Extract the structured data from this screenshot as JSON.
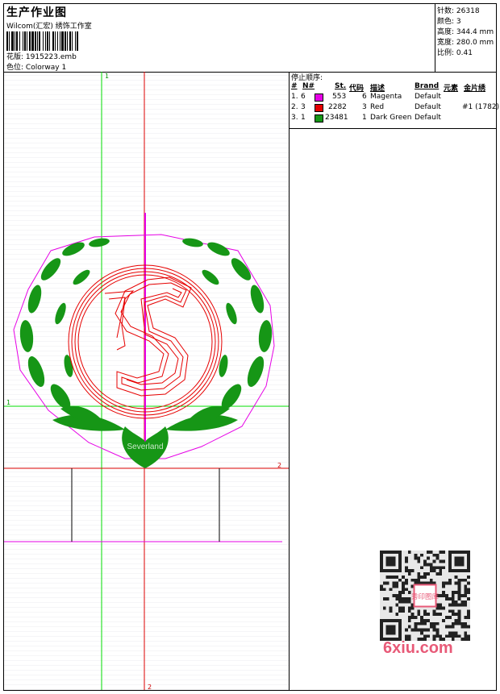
{
  "header": {
    "title": "生产作业图",
    "company": "Wilcom(汇宏) 绣饰工作室",
    "design_label": "花版:",
    "design_value": "1915223.emb",
    "colorway_label": "色位:",
    "colorway_value": "Colorway 1"
  },
  "stats": [
    {
      "label": "针数:",
      "value": "26318"
    },
    {
      "label": "颜色:",
      "value": "3"
    },
    {
      "label": "高度:",
      "value": "344.4 mm"
    },
    {
      "label": "宽度:",
      "value": "280.0 mm"
    },
    {
      "label": "比例:",
      "value": "0.41"
    }
  ],
  "stop_sequence": {
    "title": "停止顺序:",
    "headers": [
      "#",
      "N#",
      "St.",
      "代码",
      "描述",
      "Brand",
      "元素",
      "金片绣"
    ],
    "rows": [
      {
        "idx": "1.",
        "n": "6",
        "st": "553",
        "code": "6",
        "desc": "Magenta",
        "brand": "Default",
        "element": "",
        "sequin": "",
        "color": "#e600e6"
      },
      {
        "idx": "2.",
        "n": "3",
        "st": "2282",
        "code": "3",
        "desc": "Red",
        "brand": "Default",
        "element": "",
        "sequin": "#1 (1782)",
        "color": "#e60000"
      },
      {
        "idx": "3.",
        "n": "1",
        "st": "23481",
        "code": "1",
        "desc": "Dark Green",
        "brand": "Default",
        "element": "",
        "sequin": "",
        "color": "#169616"
      }
    ]
  },
  "preview": {
    "guide_labels": {
      "v1": "1",
      "h1": "1",
      "h2": "2",
      "v2": "2"
    },
    "emblem_text": "Severland",
    "colors": {
      "green_guide": "#00dd00",
      "red_guide": "#dd0000",
      "magenta": "#e600e6",
      "green": "#169616",
      "red": "#e60000"
    }
  },
  "watermark": {
    "text": "6xiu.com",
    "badge": "秀印图库",
    "color": "#e85a78"
  }
}
